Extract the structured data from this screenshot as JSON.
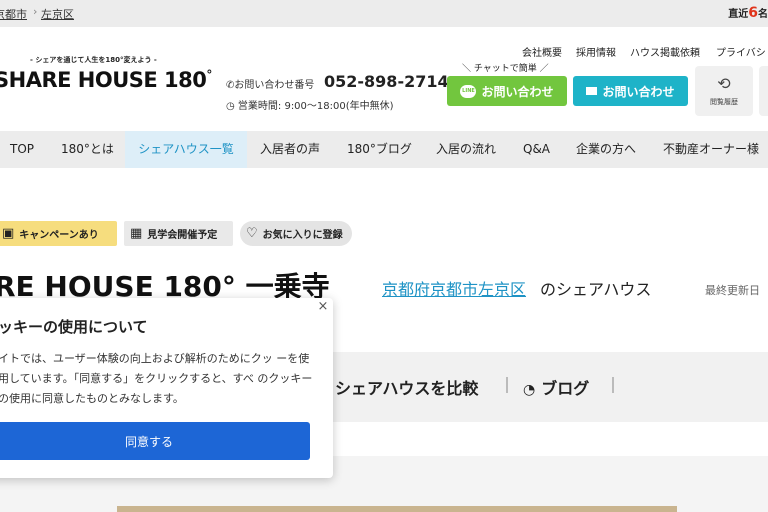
{
  "breadcrumb": {
    "items": [
      "京都市",
      "左京区"
    ],
    "separator": "›"
  },
  "recent": {
    "prefix": "直近",
    "count": "6",
    "suffix": "名"
  },
  "header": {
    "tagline": "- シェアを通じて人生を180°変えよう -",
    "logo_text": "SHARE HOUSE 180",
    "logo_degree": "°",
    "phone_label": "お問い合わせ番号",
    "phone_number": "052-898-2714",
    "hours": "営業時間: 9:00〜18:00(年中無休)",
    "top_links": [
      "会社概要",
      "採用情報",
      "ハウス掲載依頼",
      "プライバシ"
    ],
    "chat_note": "＼ チャットで簡単 ／",
    "line_button": "お問い合わせ",
    "line_icon_text": "LINE",
    "mail_button": "お問い合わせ",
    "history_button": "閲覧履歴"
  },
  "nav": {
    "items": [
      "TOP",
      "180°とは",
      "シェアハウス一覧",
      "入居者の声",
      "180°ブログ",
      "入居の流れ",
      "Q&A",
      "企業の方へ",
      "不動産オーナー様"
    ],
    "active_index": 2
  },
  "badges": {
    "campaign": "キャンペーンあり",
    "tour": "見学会開催予定",
    "favorite": "お気に入りに登録"
  },
  "property": {
    "title": "RE HOUSE 180° 一乗寺",
    "location_link": "京都府京都市左京区",
    "location_suffix": "のシェアハウス",
    "updated": "最終更新日"
  },
  "menu": {
    "compare": "シェアハウスを比較",
    "blog": "ブログ"
  },
  "cookie": {
    "close": "×",
    "title": "ッキーの使用について",
    "body": "イトでは、ユーザー体験の向上および解析のためにクッ ーを使用しています。「同意する」をクリックすると、すべ のクッキーの使用に同意したものとみなします。",
    "agree_button": "同意する"
  },
  "colors": {
    "accent_blue": "#1e93c5",
    "line_green": "#72c63e",
    "mail_teal": "#1eb3c8",
    "campaign_yellow": "#f6dd7e",
    "agree_blue": "#1d66d6",
    "recent_red": "#e0341b"
  }
}
